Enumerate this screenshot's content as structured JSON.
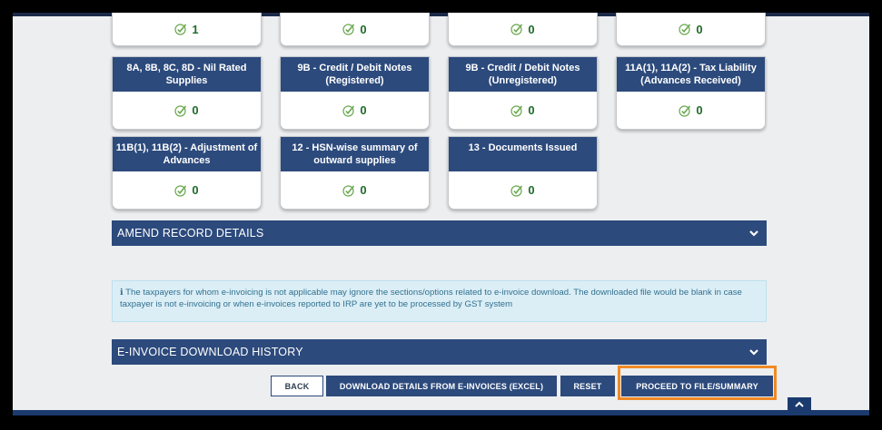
{
  "top_row": [
    {
      "count": "1"
    },
    {
      "count": "0"
    },
    {
      "count": "0"
    },
    {
      "count": "0"
    }
  ],
  "tiles": [
    {
      "title": "8A, 8B, 8C, 8D - Nil Rated Supplies",
      "count": "0"
    },
    {
      "title": "9B - Credit / Debit Notes (Registered)",
      "count": "0"
    },
    {
      "title": "9B - Credit / Debit Notes (Unregistered)",
      "count": "0"
    },
    {
      "title": "11A(1), 11A(2) - Tax Liability (Advances Received)",
      "count": "0"
    },
    {
      "title": "11B(1), 11B(2) - Adjustment of Advances",
      "count": "0"
    },
    {
      "title": "12 - HSN-wise summary of outward supplies",
      "count": "0"
    },
    {
      "title": "13 - Documents Issued",
      "count": "0"
    }
  ],
  "amend_section": {
    "label": "AMEND RECORD DETAILS"
  },
  "info": {
    "icon": "info-icon",
    "text": "ℹ The taxpayers for whom e-invoicing is not applicable may ignore the sections/options related to e-invoice download. The downloaded file would be blank in case taxpayer is not e-invoicing or when e-invoices reported to IRP are yet to be processed by GST system"
  },
  "einvoice_section": {
    "label": "E-INVOICE DOWNLOAD HISTORY"
  },
  "buttons": {
    "back": "BACK",
    "download": "DOWNLOAD DETAILS FROM E-INVOICES (EXCEL)",
    "reset": "RESET",
    "proceed": "PROCEED TO FILE/SUMMARY"
  },
  "colors": {
    "header": "#2c4a7c",
    "count": "#1e6b2a",
    "check": "#6aa84f",
    "highlight": "#f08a24",
    "info_bg": "#dbeef6"
  }
}
